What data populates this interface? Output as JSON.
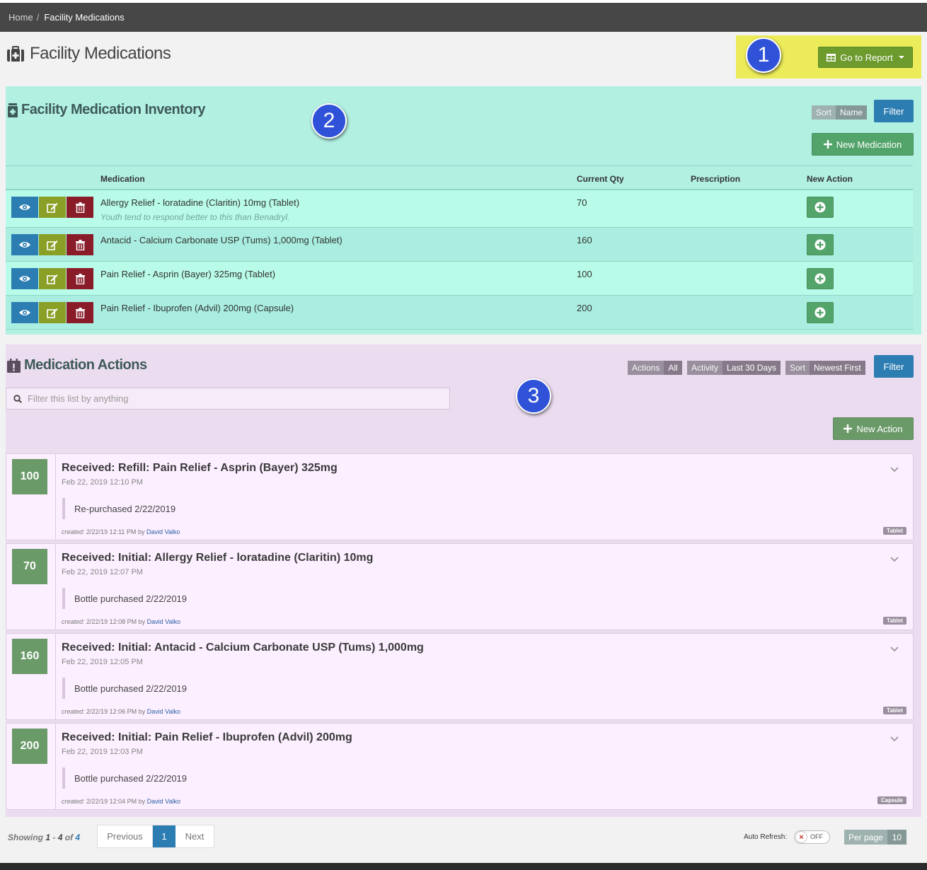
{
  "breadcrumb": {
    "home": "Home",
    "separator": "/",
    "current": "Facility Medications"
  },
  "page": {
    "title": "Facility Medications",
    "title_icon": "medkit-icon"
  },
  "report_button": {
    "label": "Go to Report",
    "icon": "table-icon"
  },
  "markers": [
    "1",
    "2",
    "3"
  ],
  "colors": {
    "inventory_bg": "#b2f0e2",
    "actions_bg": "#ebdcef",
    "highlight": "#ecec5a",
    "primary": "#2c7db1",
    "success": "#53a46a",
    "edit": "#8a9f26",
    "danger": "#8a1c2a",
    "qty_badge": "#6b9a69",
    "marker": "#2f52d8"
  },
  "inventory": {
    "title": "Facility Medication Inventory",
    "sort_key": "Sort",
    "sort_value": "Name",
    "filter_label": "Filter",
    "new_label": "New Medication",
    "columns": {
      "medication": "Medication",
      "qty": "Current Qty",
      "prescription": "Prescription",
      "new_action": "New Action"
    },
    "rows": [
      {
        "name": "Allergy Relief - loratadine (Claritin) 10mg (Tablet)",
        "note": "Youth tend to respond better to this than Benadryl.",
        "qty": "70",
        "prescription": ""
      },
      {
        "name": "Antacid - Calcium Carbonate USP (Tums) 1,000mg (Tablet)",
        "note": "",
        "qty": "160",
        "prescription": ""
      },
      {
        "name": "Pain Relief - Asprin (Bayer) 325mg (Tablet)",
        "note": "",
        "qty": "100",
        "prescription": ""
      },
      {
        "name": "Pain Relief - Ibuprofen (Advil) 200mg (Capsule)",
        "note": "",
        "qty": "200",
        "prescription": ""
      }
    ]
  },
  "actions": {
    "title": "Medication Actions",
    "filters": [
      {
        "key": "Actions",
        "value": "All"
      },
      {
        "key": "Activity",
        "value": "Last 30 Days"
      },
      {
        "key": "Sort",
        "value": "Newest First"
      }
    ],
    "filter_label": "Filter",
    "search_placeholder": "Filter this list by anything",
    "new_label": "New Action",
    "items": [
      {
        "qty": "100",
        "title": "Received: Refill: Pain Relief - Asprin (Bayer) 325mg",
        "date": "Feb 22, 2019 12:10 PM",
        "note": "Re-purchased 2/22/2019",
        "created_label": "created:",
        "created_at": "2/22/19 12:11 PM",
        "by_label": "by",
        "by": "David Valko",
        "form": "Tablet"
      },
      {
        "qty": "70",
        "title": "Received: Initial: Allergy Relief - loratadine (Claritin) 10mg",
        "date": "Feb 22, 2019 12:07 PM",
        "note": "Bottle purchased 2/22/2019",
        "created_label": "created:",
        "created_at": "2/22/19 12:08 PM",
        "by_label": "by",
        "by": "David Valko",
        "form": "Tablet"
      },
      {
        "qty": "160",
        "title": "Received: Initial: Antacid - Calcium Carbonate USP (Tums) 1,000mg",
        "date": "Feb 22, 2019 12:05 PM",
        "note": "Bottle purchased 2/22/2019",
        "created_label": "created:",
        "created_at": "2/22/19 12:06 PM",
        "by_label": "by",
        "by": "David Valko",
        "form": "Tablet"
      },
      {
        "qty": "200",
        "title": "Received: Initial: Pain Relief - Ibuprofen (Advil) 200mg",
        "date": "Feb 22, 2019 12:03 PM",
        "note": "Bottle purchased 2/22/2019",
        "created_label": "created:",
        "created_at": "2/22/19 12:04 PM",
        "by_label": "by",
        "by": "David Valko",
        "form": "Capsule"
      }
    ]
  },
  "footer": {
    "showing_label": "Showing",
    "range_start": "1",
    "range_sep": "-",
    "range_end": "4",
    "of_label": "of",
    "total": "4",
    "pager": {
      "prev": "Previous",
      "current": "1",
      "next": "Next"
    },
    "auto_refresh_label": "Auto Refresh:",
    "auto_refresh_state": "OFF",
    "auto_refresh_icon": "×",
    "per_page_label": "Per page",
    "per_page_value": "10"
  }
}
